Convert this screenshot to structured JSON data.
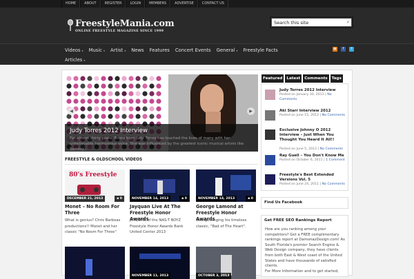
{
  "top_nav": [
    "HOME",
    "ABOUT",
    "REGISTER",
    "LOGIN",
    "MEMBERS",
    "ADVERTISE",
    "CONTACT US"
  ],
  "logo": {
    "title": "FreestyleMania.com",
    "subtitle": "ONLINE FREESTYLE MAGAZINE   SINCE 1999"
  },
  "search": {
    "placeholder": "Search this site"
  },
  "main_nav": {
    "row1": [
      "Videos",
      "Music",
      "Artist",
      "News",
      "Features",
      "Concert Events",
      "General",
      "Freestyle Facts"
    ],
    "row2": [
      "Articles"
    ],
    "has_dropdown": [
      "Videos",
      "Music",
      "Artist",
      "General",
      "Articles"
    ]
  },
  "slider": {
    "title": "Judy Torres 2012 Interview",
    "excerpt": "For almost thirty years, Bronx born Judy Torres has touched the lives of many with her unbelievable harmonious voice. She was influenced by the greatest iconic musical artists like Sammy..."
  },
  "videos_section": {
    "title": "FREESTYLE & OLDSCHOOL VIDEOS",
    "cards": [
      {
        "date": "DECEMBER 21, 2013",
        "comments": "0",
        "title": "Monet – No Room For Three",
        "excerpt": "What is genius? Chris Barboas productions!! Monet and her classic \"No Room For Three\"",
        "thumb_text": "80's Freestyle"
      },
      {
        "date": "NOVEMBER 14, 2013",
        "comments": "0",
        "title": "Jayquan Live At The Freestyle Honor Awards",
        "excerpt": "JAYQUAN of the NAS-T BOYZ Freestyle Honor Awards Bank United Center 2013",
        "thumb_text": ""
      },
      {
        "date": "NOVEMBER 14, 2013",
        "comments": "0",
        "title": "George Lamond at Freestyle Honor Awards",
        "excerpt": "George singing his timeless classic, \"Bad of The Heart\".",
        "thumb_text": ""
      },
      {
        "date": "",
        "comments": "",
        "title": "",
        "excerpt": "",
        "thumb_text": ""
      },
      {
        "date": "NOVEMBER 11, 2013",
        "comments": "",
        "title": "",
        "excerpt": "",
        "thumb_text": ""
      },
      {
        "date": "OCTOBER 3, 2013",
        "comments": "",
        "title": "",
        "excerpt": "",
        "thumb_text": ""
      }
    ]
  },
  "sidebar": {
    "tabs": [
      "Featured",
      "Latest",
      "Comments",
      "Tags"
    ],
    "featured": [
      {
        "title": "Judy Torres 2012 Interview",
        "date": "Posted on January 30, 2013",
        "comments": "No Comments"
      },
      {
        "title": "Aki Starr Interview 2012",
        "date": "Posted on June 15, 2012",
        "comments": "No Comments"
      },
      {
        "title": "Exclusive Johnny O 2012 Interview – Just When You Thought You Heard It All!!",
        "date": "Posted on June 5, 2012",
        "comments": "No Comments"
      },
      {
        "title": "Ray Guell – You Don't Know Me",
        "date": "Posted on October 6, 2011",
        "comments": "1 Comment"
      },
      {
        "title": "Freestyle's Best Extended Versions Vol. 5",
        "date": "Posted on June 24, 2011",
        "comments": "No Comments"
      }
    ],
    "facebook_title": "Find Us Facebook",
    "seo_title": "Get FREE SEO Rankings Report",
    "seo_p1": "How are you ranking among your competitors? Get a FREE complimentary rankings report at DamonazDesign.com! As South Florida's premier Search Engine & Web Design company, they have clients from both East & West coast of the United States and have thousands of satisfied clients.",
    "seo_p2": "For More Information and to get started,"
  },
  "colors": {
    "header_bg": "#2a2a2a",
    "topbar_bg": "#1a1a1a",
    "tab_bg": "#1e1e1e",
    "link": "#2f5ea8"
  },
  "icons": [
    "rss-icon",
    "facebook-icon",
    "twitter-icon",
    "search-icon",
    "comment-bubble-icon"
  ]
}
